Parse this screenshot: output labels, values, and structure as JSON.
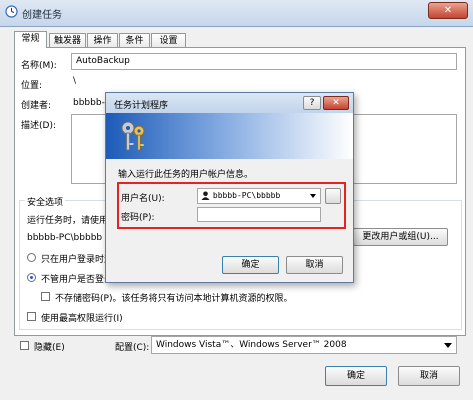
{
  "window": {
    "title": "创建任务",
    "close_glyph": "✕"
  },
  "tabs": [
    {
      "label": "常规",
      "active": true
    },
    {
      "label": "触发器"
    },
    {
      "label": "操作"
    },
    {
      "label": "条件"
    },
    {
      "label": "设置"
    }
  ],
  "general": {
    "name_label": "名称(M):",
    "name_value": "AutoBackup",
    "location_label": "位置:",
    "location_value": "\\",
    "author_label": "创建者:",
    "author_value": "bbbbb-PC\\bbbbb",
    "description_label": "描述(D):"
  },
  "security": {
    "group_label": "安全选项",
    "run_as_label": "运行任务时，请使用下列用户帐户:",
    "run_as_value": "bbbbb-PC\\bbbbb",
    "change_user_button": "更改用户或组(U)...",
    "only_logged_on": "只在用户登录时运行(R)",
    "whether_logged_on": "不管用户是否登录都要运行(W)",
    "dont_store_password": "不存储密码(P)。该任务将只有访问本地计算机资源的权限。",
    "highest_privileges": "使用最高权限运行(I)"
  },
  "bottom": {
    "hidden_label": "隐藏(E)",
    "configure_label": "配置(C):",
    "configure_value": "Windows Vista™、Windows Server™ 2008",
    "ok_button": "确定",
    "cancel_button": "取消"
  },
  "dialog": {
    "title": "任务计划程序",
    "help_glyph": "?",
    "close_glyph": "✕",
    "prompt": "输入运行此任务的用户帐户信息。",
    "username_label": "用户名(U):",
    "username_value": "bbbbb-PC\\bbbbb",
    "password_label": "密码(P):",
    "password_value": "",
    "ok_button": "确定",
    "cancel_button": "取消"
  },
  "colors": {
    "highlight_box": "#e52323",
    "banner_blue": "#1d5bb8"
  }
}
